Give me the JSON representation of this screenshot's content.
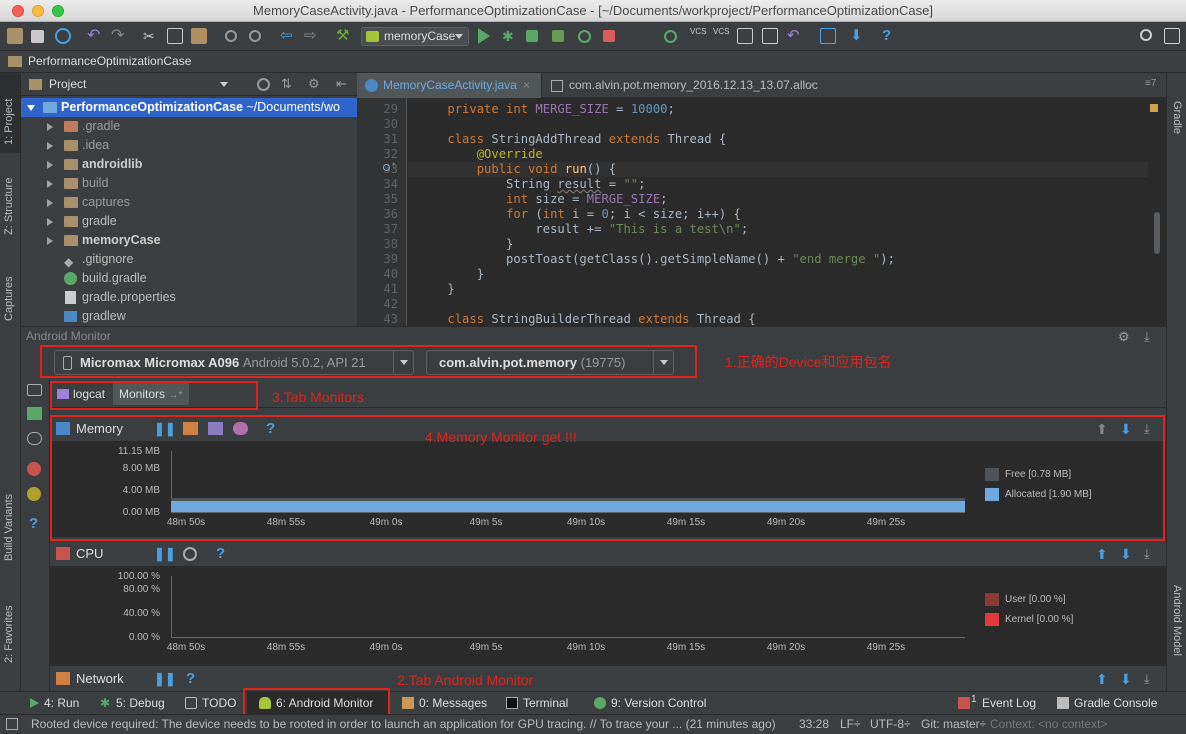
{
  "window": {
    "title": "MemoryCaseActivity.java - PerformanceOptimizationCase - [~/Documents/workproject/PerformanceOptimizationCase]"
  },
  "toolbar": {
    "run_config": "memoryCase"
  },
  "navbar": {
    "breadcrumb": "PerformanceOptimizationCase"
  },
  "left_strip": {
    "project": "1: Project",
    "structure": "Z: Structure",
    "captures": "Captures",
    "build_variants": "Build Variants",
    "favorites": "2: Favorites"
  },
  "right_strip": {
    "gradle": "Gradle",
    "android_model": "Android Model"
  },
  "project_panel": {
    "header": "Project",
    "root": {
      "name": "PerformanceOptimizationCase",
      "path": "~/Documents/wo"
    },
    "items": [
      {
        "name": ".gradle"
      },
      {
        "name": ".idea"
      },
      {
        "name": "androidlib"
      },
      {
        "name": "build"
      },
      {
        "name": "captures"
      },
      {
        "name": "gradle"
      },
      {
        "name": "memoryCase"
      },
      {
        "name": ".gitignore"
      },
      {
        "name": "build.gradle"
      },
      {
        "name": "gradle.properties"
      },
      {
        "name": "gradlew"
      }
    ]
  },
  "editor": {
    "tabs": [
      {
        "label": "MemoryCaseActivity.java"
      },
      {
        "label": "com.alvin.pot.memory_2016.12.13_13.07.alloc"
      }
    ],
    "tab_overflow": "7",
    "line_numbers": [
      "29",
      "30",
      "31",
      "32",
      "33",
      "34",
      "35",
      "36",
      "37",
      "38",
      "39",
      "40",
      "41",
      "42",
      "43"
    ]
  },
  "android_monitor": {
    "header": "Android Monitor",
    "device": "Micromax Micromax A096",
    "device_detail": "Android 5.0.2, API 21",
    "process": "com.alvin.pot.memory",
    "pid": "(19775)",
    "tabs": {
      "logcat": "logcat",
      "monitors": "Monitors"
    },
    "annotations": {
      "device": "1.正确的Device和应用包名",
      "tab_monitors": "3.Tab Monitors",
      "memory": "4.Memory Monitor get !!!",
      "tab_android_monitor": "2.Tab Android Monitor"
    },
    "memory": {
      "title": "Memory",
      "yticks": [
        "11.15 MB",
        "8.00 MB",
        "4.00 MB",
        "0.00 MB"
      ],
      "xticks": [
        "48m 50s",
        "48m 55s",
        "49m 0s",
        "49m 5s",
        "49m 10s",
        "49m 15s",
        "49m 20s",
        "49m 25s"
      ],
      "legend": [
        {
          "label": "Free [0.78 MB]",
          "color": "#4e5254"
        },
        {
          "label": "Allocated [1.90 MB]",
          "color": "#6fa8dc"
        }
      ]
    },
    "cpu": {
      "title": "CPU",
      "yticks": [
        "100.00 %",
        "80.00 %",
        "40.00 %",
        "0.00 %"
      ],
      "xticks": [
        "48m 50s",
        "48m 55s",
        "49m 0s",
        "49m 5s",
        "49m 10s",
        "49m 15s",
        "49m 20s",
        "49m 25s"
      ],
      "legend": [
        {
          "label": "User [0.00 %]",
          "color": "#8b3a3a"
        },
        {
          "label": "Kernel [0.00 %]",
          "color": "#e0393e"
        }
      ]
    },
    "network": {
      "title": "Network"
    }
  },
  "bottom_tools": {
    "run": "4: Run",
    "debug": "5: Debug",
    "todo": "TODO",
    "android_monitor": "6: Android Monitor",
    "messages": "0: Messages",
    "terminal": "Terminal",
    "version_control": "9: Version Control",
    "event_log": "Event Log",
    "event_log_count": "1",
    "gradle_console": "Gradle Console"
  },
  "status_bar": {
    "message": "Rooted device required: The device needs to be rooted in order to launch an application for GPU tracing. // To trace your ... (21 minutes ago)",
    "position": "33:28",
    "line_sep": "LF÷",
    "encoding": "UTF-8÷",
    "git": "Git: master÷",
    "context": "Context: <no context>"
  }
}
